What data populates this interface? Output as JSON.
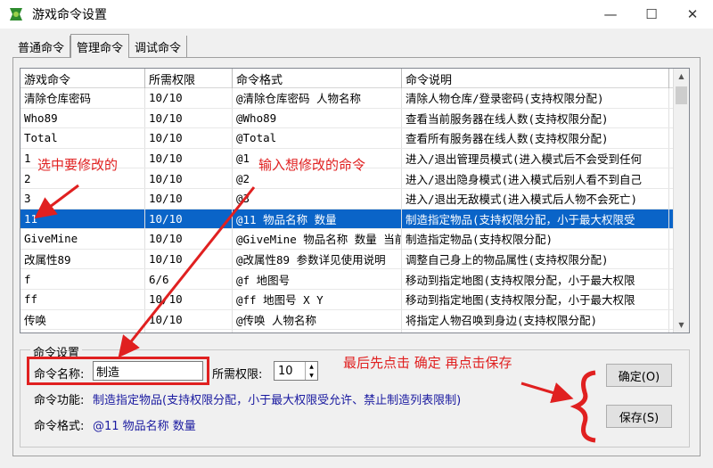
{
  "window": {
    "title": "游戏命令设置",
    "minimize": "—",
    "maximize": "☐",
    "close": "✕"
  },
  "tabs": [
    {
      "label": "普通命令",
      "active": false
    },
    {
      "label": "管理命令",
      "active": true
    },
    {
      "label": "调试命令",
      "active": false
    }
  ],
  "table": {
    "columns": [
      "游戏命令",
      "所需权限",
      "命令格式",
      "命令说明"
    ],
    "rows": [
      [
        "清除仓库密码",
        "10/10",
        "@清除仓库密码 人物名称",
        "清除人物仓库/登录密码(支持权限分配)"
      ],
      [
        "Who89",
        "10/10",
        "@Who89",
        "查看当前服务器在线人数(支持权限分配)"
      ],
      [
        "Total",
        "10/10",
        "@Total",
        "查看所有服务器在线人数(支持权限分配)"
      ],
      [
        "1",
        "10/10",
        "@1",
        "进入/退出管理员模式(进入模式后不会受到任何"
      ],
      [
        "2",
        "10/10",
        "@2",
        "进入/退出隐身模式(进入模式后别人看不到自己"
      ],
      [
        "3",
        "10/10",
        "@3",
        "进入/退出无敌模式(进入模式后人物不会死亡)"
      ],
      [
        "11",
        "10/10",
        "@11 物品名称 数量",
        "制造指定物品(支持权限分配，小于最大权限受"
      ],
      [
        "GiveMine",
        "10/10",
        "@GiveMine 物品名称 数量 当前",
        "制造指定物品(支持权限分配)"
      ],
      [
        "改属性89",
        "10/10",
        "@改属性89 参数详见使用说明",
        "调整自己身上的物品属性(支持权限分配)"
      ],
      [
        "f",
        "6/6",
        "@f 地图号",
        "移动到指定地图(支持权限分配，小于最大权限"
      ],
      [
        "ff",
        "10/10",
        "@ff 地图号 X Y",
        "移动到指定地图(支持权限分配，小于最大权限"
      ],
      [
        "传唤",
        "10/10",
        "@传唤 人物名称",
        "将指定人物召唤到身边(支持权限分配)"
      ],
      [
        "跟踪",
        "10/10",
        "@跟踪 人物名称",
        "跟踪指定人物(支持权限分配)"
      ]
    ],
    "selected_index": 6
  },
  "settings": {
    "group_title": "命令设置",
    "name_label": "命令名称:",
    "name_value": "制造",
    "permission_label": "所需权限:",
    "permission_value": "10",
    "function_label": "命令功能:",
    "function_value": "制造指定物品(支持权限分配，小于最大权限受允许、禁止制造列表限制)",
    "format_label": "命令格式:",
    "format_value": "@11 物品名称 数量"
  },
  "buttons": {
    "ok": "确定(O)",
    "save": "保存(S)"
  },
  "annotations": {
    "select": "选中要修改的",
    "input": "输入想修改的命令",
    "last": "最后先点击 确定 再点击保存",
    "color": "#e02020"
  }
}
